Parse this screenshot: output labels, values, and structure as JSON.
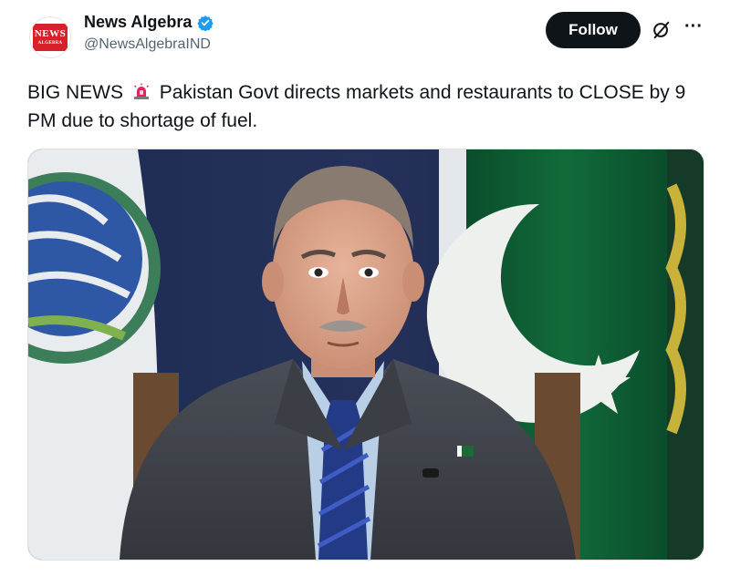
{
  "account": {
    "display_name": "News Algebra",
    "handle": "@NewsAlgebraIND",
    "logo_line1": "NEWS",
    "logo_line2": "ALGEBRA",
    "verified": true
  },
  "actions": {
    "follow_label": "Follow",
    "grok_icon": "grok-icon",
    "more_icon": "more-icon"
  },
  "tweet": {
    "text_before_emoji": "BIG NEWS",
    "emoji": "siren-icon",
    "text_after_emoji": "Pakistan Govt directs markets and restaurants to CLOSE by 9 PM due to shortage of fuel."
  },
  "media": {
    "description_icon": "photo"
  },
  "colors": {
    "follow_bg": "#0f1419",
    "verified_blue": "#1d9bf0",
    "secondary_text": "#536471",
    "flag_green": "#01411c"
  }
}
